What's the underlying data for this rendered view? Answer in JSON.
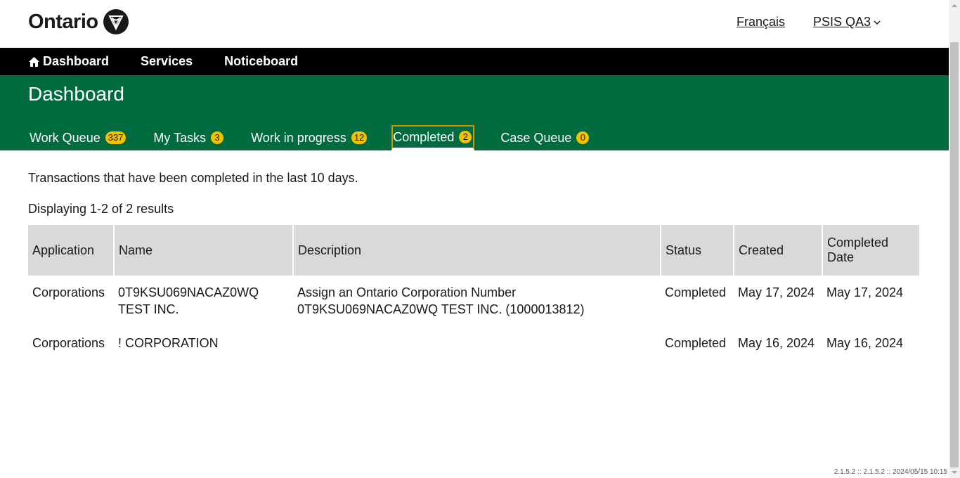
{
  "header": {
    "logo_text": "Ontario",
    "language_link": "Français",
    "user_menu": "PSIS QA3"
  },
  "nav": {
    "items": [
      {
        "label": "Dashboard",
        "icon": "home-icon"
      },
      {
        "label": "Services"
      },
      {
        "label": "Noticeboard"
      }
    ]
  },
  "band": {
    "title": "Dashboard",
    "tabs": [
      {
        "label": "Work Queue",
        "count": "337"
      },
      {
        "label": "My Tasks",
        "count": "3"
      },
      {
        "label": "Work in progress",
        "count": "12"
      },
      {
        "label": "Completed",
        "count": "2",
        "active": true
      },
      {
        "label": "Case Queue",
        "count": "0"
      }
    ]
  },
  "main": {
    "intro": "Transactions that have been completed in the last 10 days.",
    "results_count": "Displaying 1-2 of 2 results",
    "table": {
      "headers": [
        "Application",
        "Name",
        "Description",
        "Status",
        "Created",
        "Completed Date"
      ],
      "rows": [
        [
          "Corporations",
          "0T9KSU069NACAZ0WQ TEST INC.",
          "Assign an Ontario Corporation Number 0T9KSU069NACAZ0WQ TEST INC. (1000013812)",
          "Completed",
          "May 17, 2024",
          "May 17, 2024"
        ],
        [
          "Corporations",
          "! CORPORATION",
          "",
          "Completed",
          "May 16, 2024",
          "May 16, 2024"
        ]
      ]
    }
  },
  "footer": {
    "version": "2.1.5.2 :: 2.1.5.2 :: 2024/05/15 10:15"
  },
  "colors": {
    "nav_bg": "#000000",
    "band_bg": "#006b3f",
    "badge_bg": "#f2c100",
    "active_tab_border": "#c89500",
    "table_header_bg": "#d9d9d9"
  }
}
